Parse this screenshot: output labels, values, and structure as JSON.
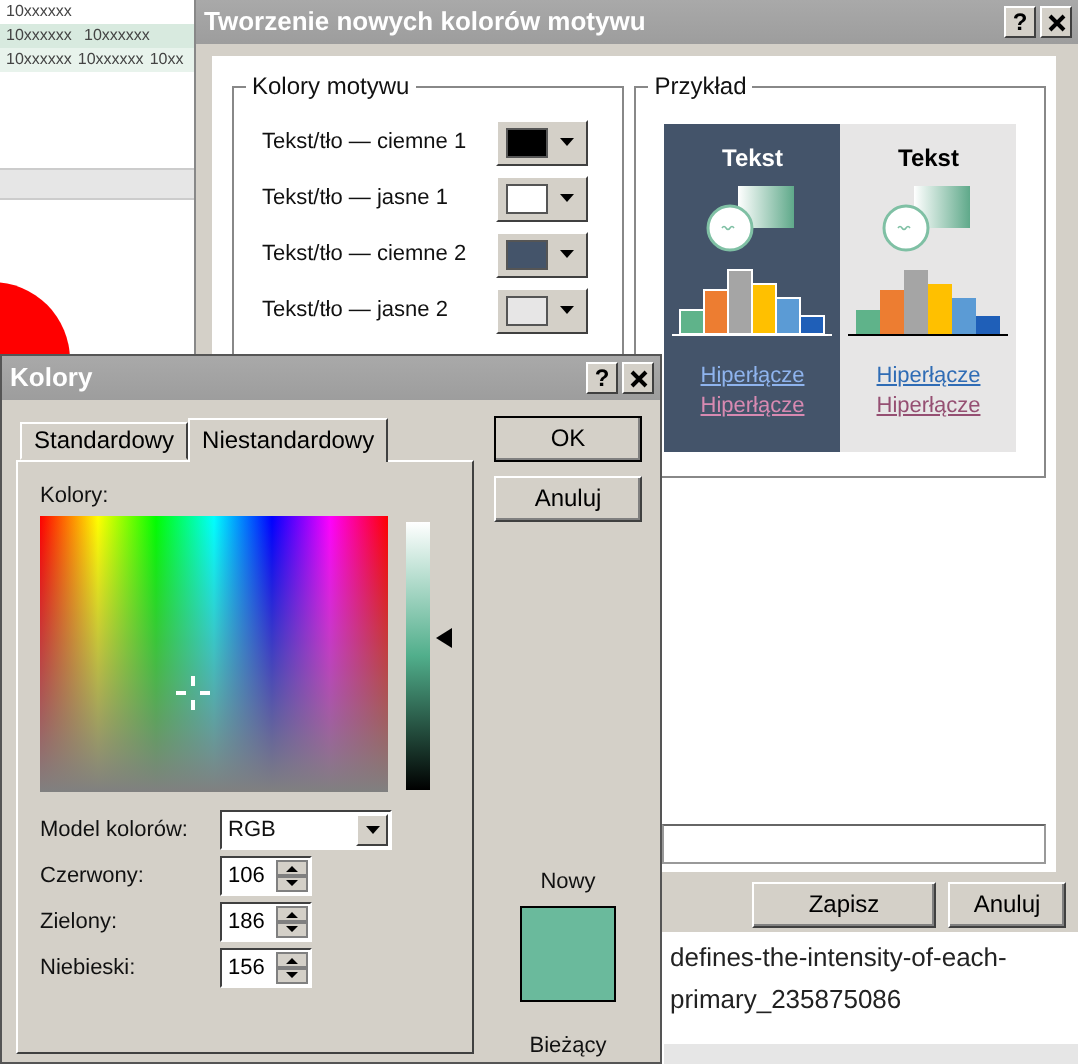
{
  "sheet": {
    "rows": [
      [
        "10xxxxxx"
      ],
      [
        "10xxxxxx",
        "10xxxxxx"
      ],
      [
        "10xxxxxx",
        "10xxxxxx",
        "10xx"
      ]
    ]
  },
  "theme_dialog": {
    "title": "Tworzenie nowych kolorów motywu",
    "help_button": "?",
    "theme_colors": {
      "legend": "Kolory motywu",
      "rows": [
        {
          "label": "Tekst/tło — ciemne 1",
          "color": "#000000"
        },
        {
          "label": "Tekst/tło — jasne 1",
          "color": "#ffffff"
        },
        {
          "label": "Tekst/tło — ciemne 2",
          "color": "#44546a"
        },
        {
          "label": "Tekst/tło — jasne 2",
          "color": "#e7e6e6"
        }
      ]
    },
    "sample": {
      "legend": "Przykład",
      "panels": [
        {
          "kind": "dark",
          "heading": "Tekst",
          "links": [
            "Hiperłącze",
            "Hiperłącze"
          ]
        },
        {
          "kind": "light",
          "heading": "Tekst",
          "links": [
            "Hiperłącze",
            "Hiperłącze"
          ]
        }
      ]
    },
    "buttons": [
      "Zapisz",
      "Anuluj"
    ]
  },
  "colors_dialog": {
    "title": "Kolory",
    "help_button": "?",
    "tabs": [
      {
        "label": "Standardowy",
        "selected": false
      },
      {
        "label": "Niestandardowy",
        "selected": true
      }
    ],
    "spectrum_label": "Kolory:",
    "model": {
      "label": "Model kolorów:",
      "value": "RGB"
    },
    "channels": [
      {
        "label": "Czerwony:",
        "value": "106"
      },
      {
        "label": "Zielony:",
        "value": "186"
      },
      {
        "label": "Niebieski:",
        "value": "156"
      }
    ],
    "buttons": [
      "OK",
      "Anuluj"
    ],
    "new_label": "Nowy",
    "current_label": "Bieżący"
  },
  "caption": "defines-the-intensity-of-each-primary_235875086"
}
